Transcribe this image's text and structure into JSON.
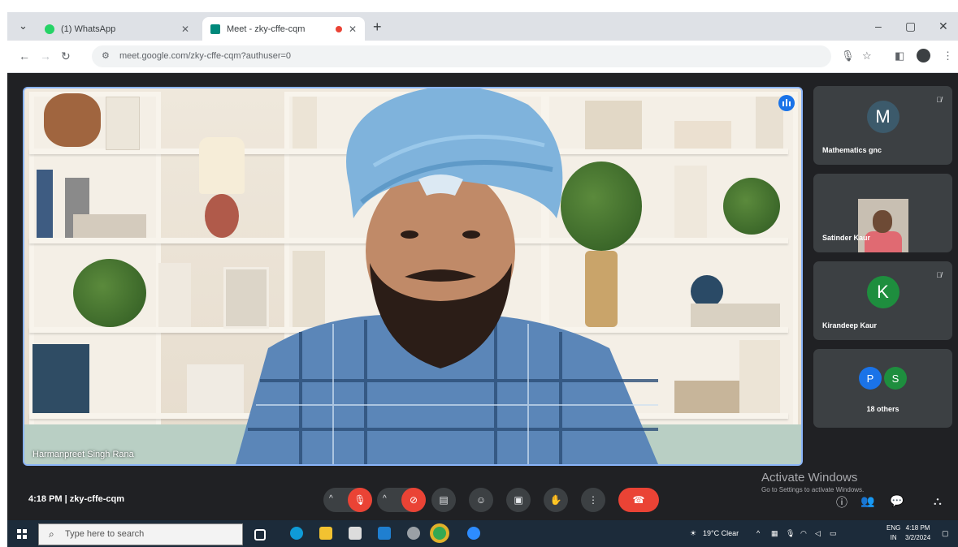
{
  "browser": {
    "tabs": [
      {
        "label": "(1) WhatsApp",
        "active": false,
        "icon": "whatsapp-icon",
        "color": "#25d366"
      },
      {
        "label": "Meet - zky-cffe-cqm",
        "active": true,
        "icon": "meet-icon",
        "color": "#00897b"
      }
    ],
    "new_tab": "+",
    "window_controls": [
      "–",
      "▢",
      "✕"
    ],
    "url": "meet.google.com/zky-cffe-cqm?authuser=0"
  },
  "meet": {
    "main_speaker_label": "Harmanpreet Singh Rana",
    "participants": [
      {
        "name": "Mathematics gnc",
        "initial": "M",
        "color": "#3c5a6b",
        "muted": true,
        "camera": false
      },
      {
        "name": "Satinder Kaur",
        "initial": "",
        "color": "",
        "muted": false,
        "camera": true
      },
      {
        "name": "Kirandeep Kaur",
        "initial": "K",
        "color": "#1e8e3e",
        "muted": true,
        "camera": false
      }
    ],
    "others": {
      "label": "18 others",
      "avatars": [
        {
          "initial": "P",
          "color": "#1a73e8"
        },
        {
          "initial": "S",
          "color": "#1e8e3e"
        }
      ]
    },
    "time": "4:18 PM",
    "separator": "|",
    "meeting_code": "zky-cffe-cqm",
    "activate_windows": {
      "title": "Activate Windows",
      "subtitle": "Go to Settings to activate Windows."
    }
  },
  "taskbar": {
    "search_placeholder": "Type here to search",
    "weather": "19°C Clear",
    "language": {
      "line1": "ENG",
      "line2": "IN"
    },
    "clock": {
      "time": "4:18 PM",
      "date": "3/2/2024"
    }
  }
}
